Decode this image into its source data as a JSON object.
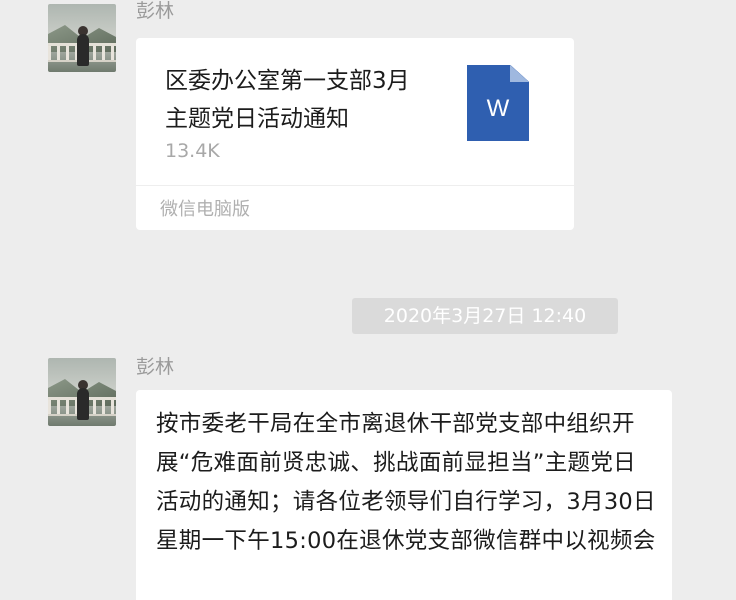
{
  "messages": [
    {
      "sender": "彭林",
      "file": {
        "title": "区委办公室第一支部3月主题党日活动通知",
        "size": "13.4K",
        "source": "微信电脑版",
        "icon": "word-document-icon",
        "icon_letter": "W",
        "icon_color": "#2f5fb0"
      }
    },
    {
      "sender": "彭林",
      "text": "按市委老干局在全市离退休干部党支部中组织开展“危难面前贤忠诚、挑战面前显担当”主题党日活动的通知；请各位老领导们自行学习，3月30日星期一下午15:00在退休党支部微信群中以视频会"
    }
  ],
  "timestamp": "2020年3月27日 12:40",
  "colors": {
    "background": "#ededed",
    "bubble": "#ffffff",
    "timestamp_bg": "#dadada"
  }
}
